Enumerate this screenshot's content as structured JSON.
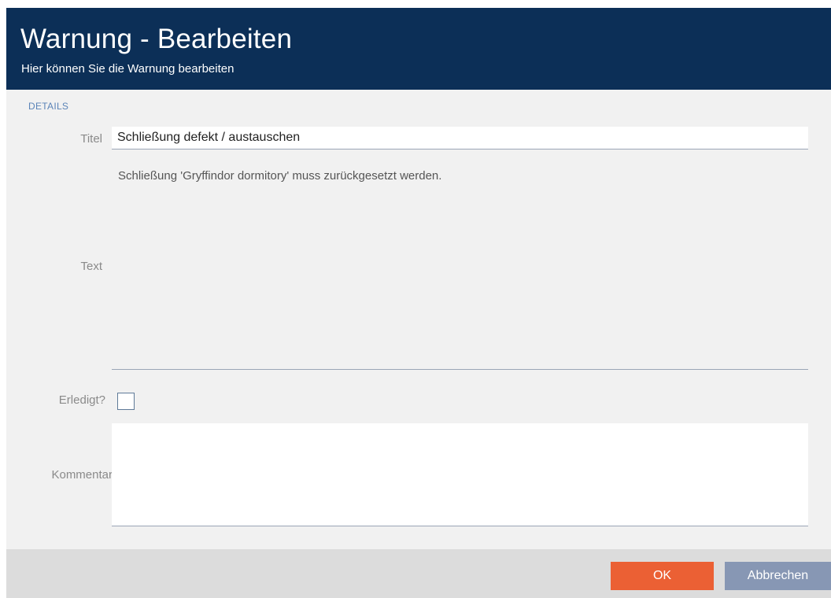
{
  "header": {
    "title": "Warnung - Bearbeiten",
    "subtitle": "Hier können Sie die Warnung bearbeiten"
  },
  "details": {
    "section_label": "DETAILS",
    "title_label": "Titel",
    "title_value": "Schließung defekt / austauschen",
    "text_label": "Text",
    "text_value": "Schließung 'Gryffindor dormitory' muss zurückgesetzt werden.",
    "done_label": "Erledigt?",
    "done_checked": false,
    "comment_label": "Kommentar",
    "comment_value": ""
  },
  "footer": {
    "ok_label": "OK",
    "cancel_label": "Abbrechen"
  },
  "colors": {
    "header_bg": "#0c2f57",
    "ok_button": "#eb6034",
    "cancel_button": "#8797b4",
    "section_label": "#5b84b8"
  }
}
